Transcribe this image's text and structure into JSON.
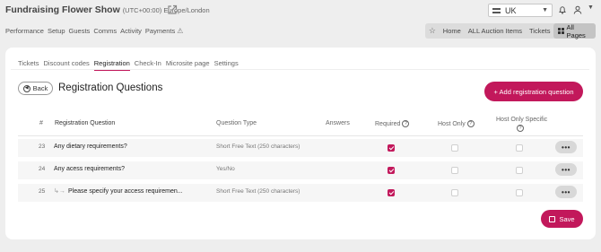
{
  "header": {
    "event_name": "Fundraising Flower Show",
    "timezone": "(UTC+00:00) Europe/London",
    "region": "UK"
  },
  "main_nav": [
    "Performance",
    "Setup",
    "Guests",
    "Comms",
    "Activity",
    "Payments"
  ],
  "quick_links": [
    "Home",
    "ALL Auction Items",
    "Tickets"
  ],
  "all_pages_label": "All Pages",
  "sub_tabs": [
    "Tickets",
    "Discount codes",
    "Registration",
    "Check-In",
    "Microsite page",
    "Settings"
  ],
  "back_label": "Back",
  "page_title": "Registration Questions",
  "add_button_label": "+ Add registration question",
  "table": {
    "headers": {
      "number": "#",
      "question": "Registration Question",
      "type": "Question Type",
      "answers": "Answers",
      "required": "Required",
      "host_only": "Host Only",
      "host_only_specific": "Host Only Specific"
    },
    "rows": [
      {
        "num": "23",
        "question": "Any dietary requirements?",
        "type": "Short Free Text (250 characters)",
        "required": true,
        "host_only": false,
        "host_only_specific": false,
        "child": false
      },
      {
        "num": "24",
        "question": "Any acess requirements?",
        "type": "Yes/No",
        "required": true,
        "host_only": false,
        "host_only_specific": false,
        "child": false
      },
      {
        "num": "25",
        "question": "Please specify your access requiremen...",
        "type": "Short Free Text (250 characters)",
        "required": true,
        "host_only": false,
        "host_only_specific": false,
        "child": true
      }
    ],
    "more_label": "•••"
  },
  "save_label": "Save",
  "colors": {
    "accent": "#c2185b"
  }
}
